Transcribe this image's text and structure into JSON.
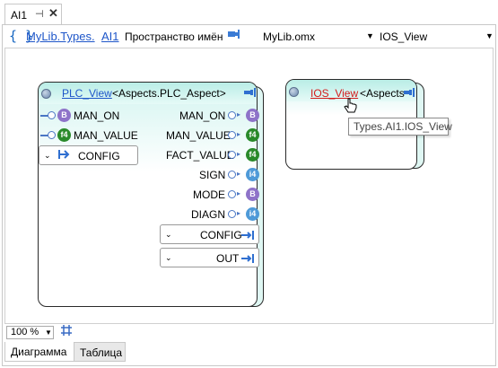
{
  "tab": {
    "label": "AI1",
    "pin_icon": "⊣",
    "close_icon": "✕"
  },
  "pathbar": {
    "brace_icon": "{ }",
    "lib_link": "MyLib.Types.",
    "ai_link": "AI1",
    "namespace_label": "Пространство имён",
    "pin_icon": "⊳",
    "file": "MyLib.omx",
    "view": "IOS_View",
    "arrow": "▼"
  },
  "blocks": {
    "plc": {
      "title_link": "PLC_View",
      "title_rest": "<Aspects.PLC_Aspect>",
      "inputs": [
        {
          "label": "MAN_ON",
          "badge": "B"
        },
        {
          "label": "MAN_VALUE",
          "badge": "f4"
        }
      ],
      "outputs": [
        {
          "label": "MAN_ON",
          "badge": "B"
        },
        {
          "label": "MAN_VALUE",
          "badge": "f4"
        },
        {
          "label": "FACT_VALUE",
          "badge": "f4"
        },
        {
          "label": "SIGN",
          "badge": "i4"
        },
        {
          "label": "MODE",
          "badge": "B"
        },
        {
          "label": "DIAGN",
          "badge": "i4"
        }
      ],
      "config_in": "CONFIG",
      "config_out": "CONFIG",
      "out_group": "OUT"
    },
    "ios": {
      "title_link": "IOS_View",
      "title_rest": "<Aspects"
    }
  },
  "tooltip": "Types.AI1.IOS_View",
  "zoom": {
    "value": "100 %",
    "arrow": "⌄"
  },
  "bottom_tabs": [
    "Диаграмма",
    "Таблица"
  ],
  "icons": {
    "block_port": "⇨",
    "chevron_down": "⌄",
    "chevron_right": "▸",
    "output_arrow": "→",
    "cursor": "hand-cursor"
  }
}
